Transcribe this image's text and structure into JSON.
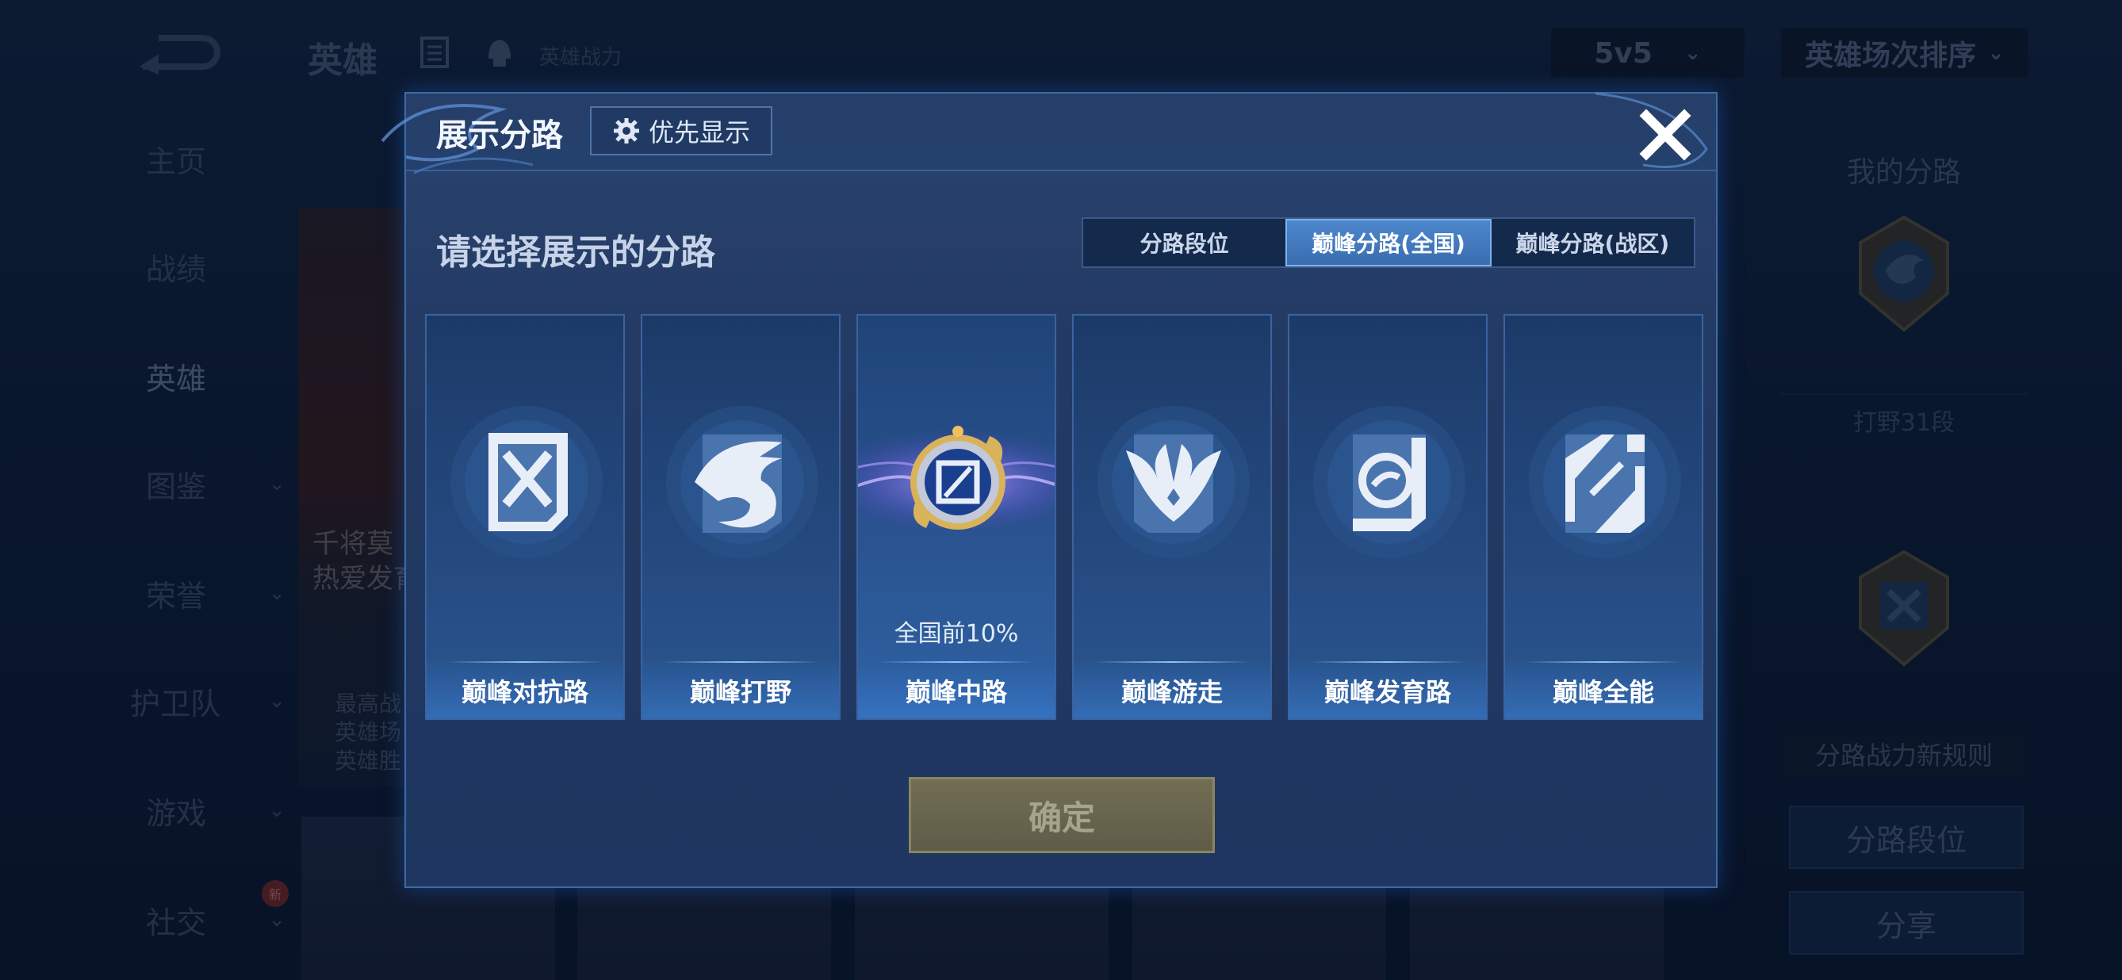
{
  "background": {
    "title": "英雄",
    "subtitle": "英雄战力",
    "mode_select": "5v5",
    "sort_select": "英雄场次排序",
    "nav": [
      {
        "label": "主页"
      },
      {
        "label": "战绩"
      },
      {
        "label": "英雄"
      },
      {
        "label": "图鉴"
      },
      {
        "label": "荣誉"
      },
      {
        "label": "护卫队"
      },
      {
        "label": "游戏"
      },
      {
        "label": "社交",
        "badge": "新"
      }
    ],
    "hero_panel": {
      "line1": "千将莫",
      "line2": "热爱发育",
      "stats": [
        "最高战",
        "英雄场",
        "英雄胜"
      ]
    },
    "right": {
      "my_lane": "我的分路",
      "jungle_tier": "打野31段",
      "rule_link": "分路战力新规则",
      "lane_tier_button": "分路段位",
      "share_button": "分享"
    }
  },
  "modal": {
    "title": "展示分路",
    "priority_button": "优先显示",
    "prompt": "请选择展示的分路",
    "tabs": [
      {
        "label": "分路段位",
        "active": false
      },
      {
        "label": "巅峰分路(全国)",
        "active": true
      },
      {
        "label": "巅峰分路(战区)",
        "active": false
      }
    ],
    "lanes": [
      {
        "name": "巅峰对抗路",
        "icon": "clash-lane-icon",
        "note": ""
      },
      {
        "name": "巅峰打野",
        "icon": "jungle-dragon-icon",
        "note": ""
      },
      {
        "name": "巅峰中路",
        "icon": "mid-lane-badge-icon",
        "note": "全国前10%",
        "selected": true
      },
      {
        "name": "巅峰游走",
        "icon": "roam-wings-icon",
        "note": ""
      },
      {
        "name": "巅峰发育路",
        "icon": "farm-lane-icon",
        "note": ""
      },
      {
        "name": "巅峰全能",
        "icon": "all-round-icon",
        "note": ""
      }
    ],
    "confirm_button": "确定"
  },
  "colors": {
    "accent_tab": "#4d87cc",
    "modal_bg": "#233b64",
    "confirm_disabled": "#6b6850"
  }
}
